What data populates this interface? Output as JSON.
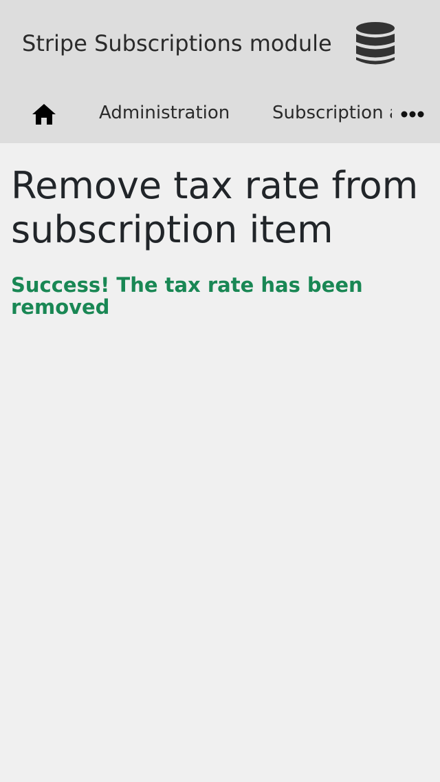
{
  "header": {
    "title": "Stripe Subscriptions module",
    "icon": "database-icon"
  },
  "nav": {
    "home_icon": "home-icon",
    "items": [
      {
        "label": "Administration"
      },
      {
        "label": "Subscription and products"
      }
    ],
    "more_icon": "more-horizontal-icon"
  },
  "main": {
    "title": "Remove tax rate from subscription item",
    "message": "Success! The tax rate has been removed"
  },
  "colors": {
    "header_bg": "#dddddd",
    "page_bg": "#f0f0f0",
    "success": "#198754"
  }
}
